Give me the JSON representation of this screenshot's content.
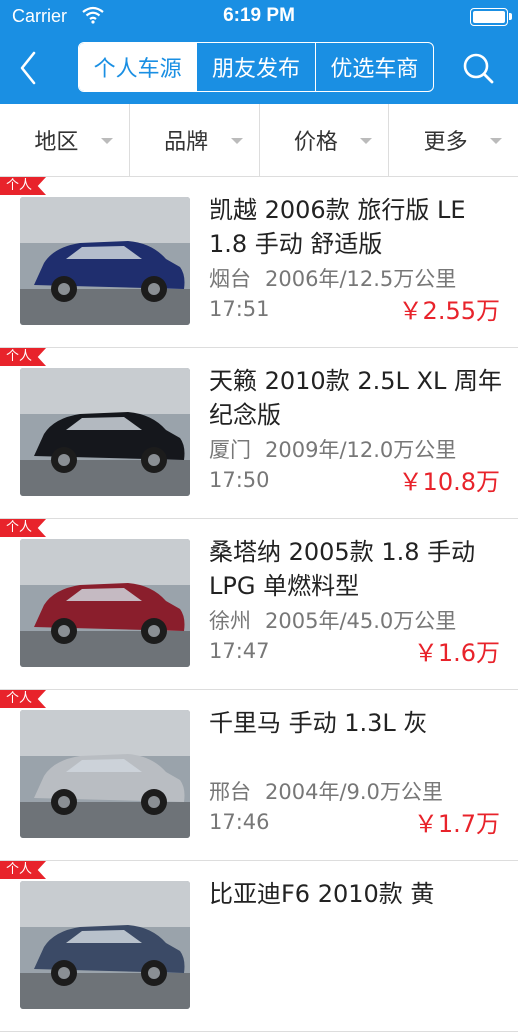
{
  "status_bar": {
    "carrier": "Carrier",
    "time": "6:19 PM"
  },
  "nav": {
    "back_icon": "chevron-left-icon",
    "search_icon": "search-icon",
    "segments": [
      {
        "label": "个人车源",
        "selected": true
      },
      {
        "label": "朋友发布",
        "selected": false
      },
      {
        "label": "优选车商",
        "selected": false
      }
    ]
  },
  "filters": [
    {
      "label": "地区"
    },
    {
      "label": "品牌"
    },
    {
      "label": "价格"
    },
    {
      "label": "更多"
    }
  ],
  "listings": [
    {
      "tag": "个人",
      "title": "凯越 2006款 旅行版 LE 1.8 手动 舒适版",
      "city": "烟台",
      "detail": "2006年/12.5万公里",
      "time": "17:51",
      "price": "￥2.55万",
      "car_color": "#1f2e6e"
    },
    {
      "tag": "个人",
      "title": "天籁 2010款 2.5L XL 周年纪念版",
      "city": "厦门",
      "detail": "2009年/12.0万公里",
      "time": "17:50",
      "price": "￥10.8万",
      "car_color": "#15171c"
    },
    {
      "tag": "个人",
      "title": "桑塔纳 2005款 1.8 手动 LPG 单燃料型",
      "city": "徐州",
      "detail": "2005年/45.0万公里",
      "time": "17:47",
      "price": "￥1.6万",
      "car_color": "#8a1e2c"
    },
    {
      "tag": "个人",
      "title": "千里马 手动 1.3L 灰",
      "city": "邢台",
      "detail": "2004年/9.0万公里",
      "time": "17:46",
      "price": "￥1.7万",
      "car_color": "#b9bdc2"
    },
    {
      "tag": "个人",
      "title": "比亚迪F6 2010款 黄",
      "city": "",
      "detail": "",
      "time": "",
      "price": "",
      "car_color": "#3b4a66"
    }
  ],
  "colors": {
    "brand": "#1a8fe3",
    "price": "#e8232b",
    "tag": "#e8232b"
  }
}
